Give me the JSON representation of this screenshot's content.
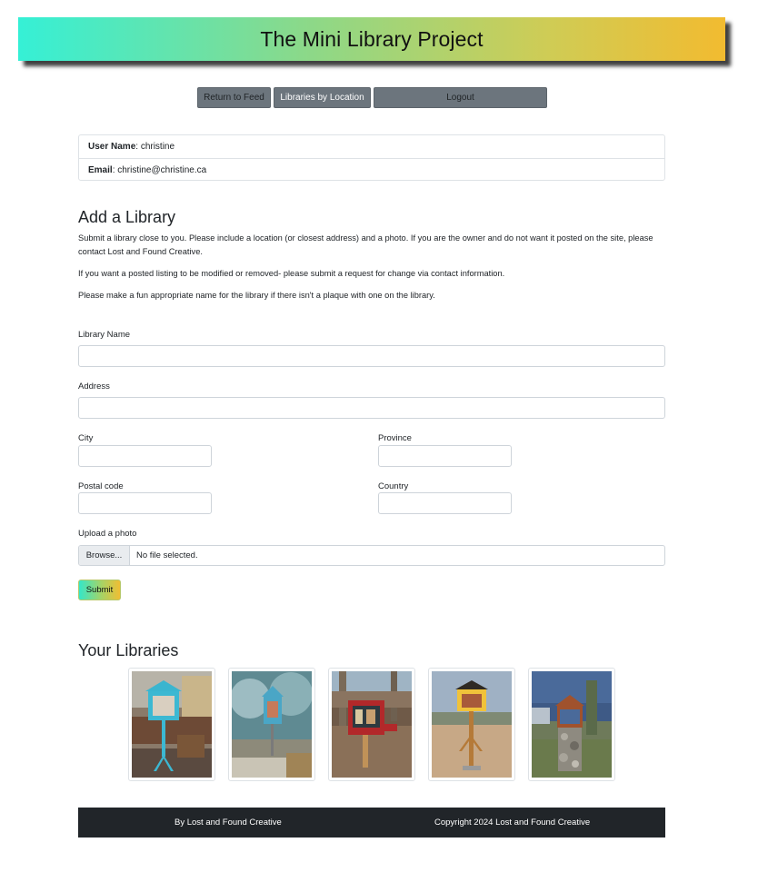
{
  "header": {
    "title": "The Mini Library Project"
  },
  "nav": {
    "return_label": "Return to Feed",
    "location_label": "Libraries by Location",
    "logout_label": "Logout"
  },
  "user": {
    "name_label": "User Name",
    "name_value": ": christine",
    "email_label": "Email",
    "email_value": ": christine@christine.ca"
  },
  "add_library": {
    "title": "Add a Library",
    "paragraphs": [
      "Submit a library close to you. Please include a location (or closest address) and a photo. If you are the owner and do not want it posted on the site, please contact Lost and Found Creative.",
      "If you want a posted listing to be modified or removed- please submit a request for change via contact information.",
      "Please make a fun appropriate name for the library if there isn't a plaque with one on the library."
    ]
  },
  "form": {
    "library_name_label": "Library Name",
    "library_name_value": "",
    "address_label": "Address",
    "address_value": "",
    "city_label": "City",
    "city_value": "",
    "province_label": "Province",
    "province_value": "",
    "postal_label": "Postal code",
    "postal_value": "",
    "country_label": "Country",
    "country_value": "",
    "upload_label": "Upload a photo",
    "browse_label": "Browse...",
    "file_status": "No file selected.",
    "submit_label": "Submit"
  },
  "your_libraries": {
    "title": "Your Libraries",
    "photos": [
      {
        "description": "blue-library-photo"
      },
      {
        "description": "snowy-blue-library-photo"
      },
      {
        "description": "red-library-photo"
      },
      {
        "description": "yellow-library-photo"
      },
      {
        "description": "stone-base-library-photo"
      }
    ]
  },
  "footer": {
    "left": "By Lost and Found Creative",
    "right": "Copyright 2024 Lost and Found Creative"
  },
  "colors": {
    "banner_start": "#35f0d6",
    "banner_end": "#f2bb30",
    "nav_button": "#6c757d",
    "footer": "#212529"
  }
}
